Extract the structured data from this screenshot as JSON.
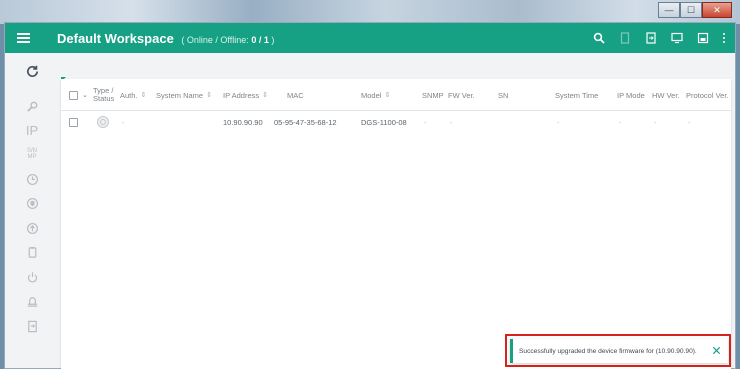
{
  "app": {
    "workspace_title": "Default Workspace",
    "status_prefix": "( Online / Offline:",
    "status_count": "0 / 1",
    "status_suffix": ")"
  },
  "window": {
    "buttons": [
      "—",
      "☐",
      "✕"
    ]
  },
  "toolbar": {
    "icons": [
      "search-icon",
      "document-icon",
      "export-icon",
      "monitor-icon",
      "save-icon",
      "more-icon"
    ]
  },
  "rail": {
    "items": [
      "refresh-icon",
      "search-icon",
      "ip-icon",
      "snmp-icon",
      "clock-icon",
      "shield-icon",
      "firmware-upgrade-icon",
      "config-icon",
      "power-icon",
      "notification-icon",
      "report-icon"
    ],
    "ip_label": "IP",
    "snmp_label_top": "S/N",
    "snmp_label_bottom": "MP"
  },
  "table": {
    "columns": {
      "type_status_top": "Type /",
      "type_status_bottom": "Status",
      "auth": "Auth.",
      "system_name": "System Name",
      "ip_address": "IP Address",
      "mac": "MAC",
      "model": "Model",
      "snmp": "SNMP",
      "fw_ver": "FW Ver.",
      "sn": "SN",
      "system_time": "System Time",
      "ip_mode": "IP Mode",
      "hw_ver": "HW Ver.",
      "protocol_ver": "Protocol Ver."
    },
    "sort_glyph": "⇕",
    "rows": [
      {
        "auth": "-",
        "system_name": "",
        "ip_address": "10.90.90.90",
        "mac": "05-95-47-35-68-12",
        "model": "DGS-1100-08",
        "snmp": "-",
        "fw_ver": "-",
        "sn": "",
        "system_time": "-",
        "ip_mode": "-",
        "hw_ver": "-",
        "protocol_ver": "-"
      }
    ]
  },
  "toast": {
    "message": "Successfully upgraded the device firmware for (10.90.90.90)."
  },
  "colors": {
    "accent": "#16a084",
    "highlight": "#d8231c"
  }
}
